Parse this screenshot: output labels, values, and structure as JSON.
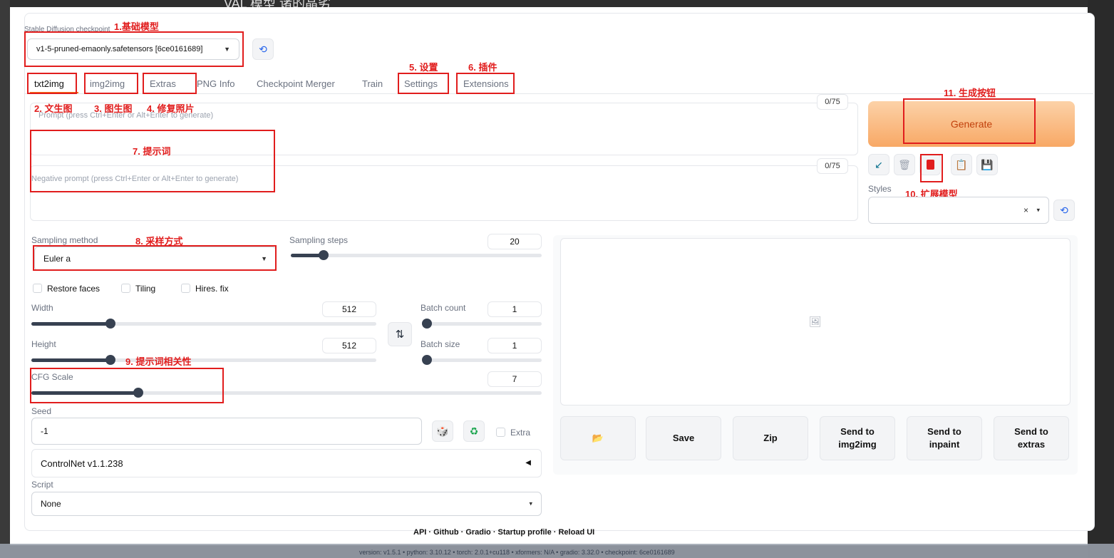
{
  "top_clip_text": "VAL 模型 诸的晶劣",
  "checkpoint": {
    "label": "Stable Diffusion checkpoint",
    "value": "v1-5-pruned-emaonly.safetensors [6ce0161689]"
  },
  "tabs": [
    {
      "label": "txt2img",
      "active": true
    },
    {
      "label": "img2img"
    },
    {
      "label": "Extras"
    },
    {
      "label": "PNG Info"
    },
    {
      "label": "Checkpoint Merger"
    },
    {
      "label": "Train"
    },
    {
      "label": "Settings"
    },
    {
      "label": "Extensions"
    }
  ],
  "prompt": {
    "placeholder": "Prompt (press Ctrl+Enter or Alt+Enter to generate)",
    "counter": "0/75"
  },
  "negative_prompt": {
    "placeholder": "Negative prompt (press Ctrl+Enter or Alt+Enter to generate)",
    "counter": "0/75"
  },
  "generate_label": "Generate",
  "styles_label": "Styles",
  "sampling": {
    "method_label": "Sampling method",
    "method_value": "Euler a",
    "steps_label": "Sampling steps",
    "steps_value": "20",
    "steps_fraction": 0.13
  },
  "checkboxes": [
    "Restore faces",
    "Tiling",
    "Hires. fix"
  ],
  "width": {
    "label": "Width",
    "value": "512",
    "fraction": 0.23
  },
  "height": {
    "label": "Height",
    "value": "512",
    "fraction": 0.23
  },
  "batch_count": {
    "label": "Batch count",
    "value": "1",
    "fraction": 0.0
  },
  "batch_size": {
    "label": "Batch size",
    "value": "1",
    "fraction": 0.0
  },
  "cfg": {
    "label": "CFG Scale",
    "value": "7",
    "fraction": 0.21
  },
  "seed": {
    "label": "Seed",
    "value": "-1",
    "extra_label": "Extra"
  },
  "controlnet_label": "ControlNet v1.1.238",
  "script": {
    "label": "Script",
    "value": "None"
  },
  "action_buttons": [
    "Save",
    "Zip",
    "Send to\nimg2img",
    "Send to\ninpaint",
    "Send to\nextras"
  ],
  "annotations": {
    "a1": "1.基础模型",
    "a2": "2. 文生图",
    "a3": "3. 图生图",
    "a4": "4. 修复照片",
    "a5": "5. 设置",
    "a6": "6. 插件",
    "a7": "7. 提示词",
    "a8": "8. 采样方式",
    "a9": "9. 提示词相关性",
    "a10": "10. 扩展模型",
    "a11": "11. 生成按钮"
  },
  "footer": {
    "links": "API  ·  Github  ·  Gradio  ·  Startup profile  ·  Reload UI",
    "version": "version: v1.5.1  •  python: 3.10.12  •  torch: 2.0.1+cu118  •  xformers: N/A  •  gradio: 3.32.0  •  checkpoint: 6ce0161689"
  },
  "colors": {
    "annotation_red": "#e11d1d",
    "generate_bg": "#f8a865",
    "generate_text": "#c2410c"
  }
}
